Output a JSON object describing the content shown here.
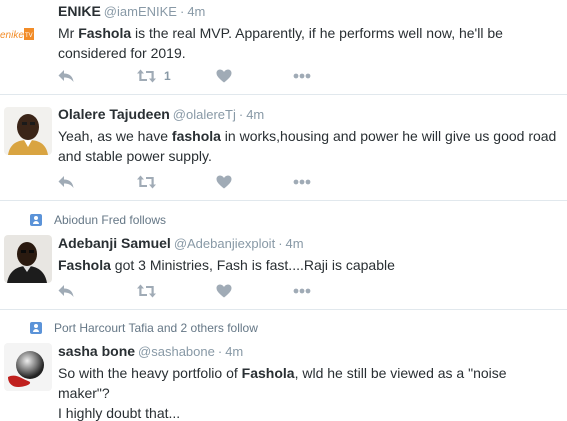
{
  "tweets": [
    {
      "fullname": "ENIKE",
      "username": "@iamENIKE",
      "dot": "·",
      "time": "4m",
      "text_parts": [
        "Mr ",
        "Fashola",
        " is the real MVP. Apparently, if he performs well now, he'll be considered for 2019."
      ],
      "retweet_count": "1",
      "avatar_text": "enike"
    },
    {
      "fullname": "Olalere Tajudeen",
      "username": "@olalereTj",
      "dot": "·",
      "time": "4m",
      "text_parts": [
        "Yeah, as we have ",
        "fashola",
        " in works,housing and power he will give us good road and stable power supply."
      ],
      "retweet_count": ""
    },
    {
      "context": "Abiodun Fred follows",
      "fullname": "Adebanji Samuel",
      "username": "@Adebanjiexploit",
      "dot": "·",
      "time": "4m",
      "text_parts": [
        "",
        "Fashola",
        " got 3 Ministries, Fash is fast....Raji is capable"
      ],
      "retweet_count": ""
    },
    {
      "context": "Port Harcourt Tafia and 2 others follow",
      "fullname": "sasha bone",
      "username": "@sashabone",
      "dot": "·",
      "time": "4m",
      "text_parts": [
        "So with the heavy portfolio of ",
        "Fashola",
        ", wld he still be viewed as a \"noise maker\"?"
      ],
      "text_line2": "I highly doubt that...",
      "retweet_count": ""
    }
  ],
  "colors": {
    "icon": "#a0abb6",
    "meta": "#8899a6",
    "text": "#292f33",
    "context_icon": "#5b93d8",
    "divider": "#e1e8ed"
  },
  "icons": [
    "reply-icon",
    "retweet-icon",
    "like-icon",
    "more-icon",
    "follow-context-icon"
  ]
}
